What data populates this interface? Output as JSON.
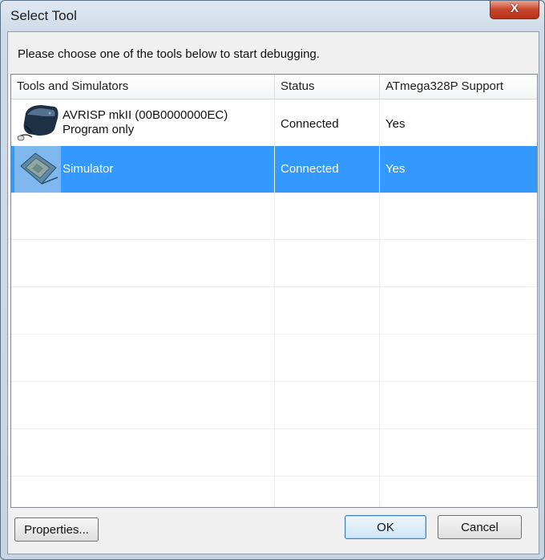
{
  "window": {
    "title": "Select Tool",
    "close_glyph": "X"
  },
  "instruction": "Please choose one of the tools below to start debugging.",
  "columns": [
    "Tools and Simulators",
    "Status",
    "ATmega328P Support"
  ],
  "rows": [
    {
      "name": "AVRISP mkII (00B0000000EC)",
      "subtitle": "Program only",
      "status": "Connected",
      "support": "Yes",
      "icon": "programmer-device-icon",
      "selected": false
    },
    {
      "name": "Simulator",
      "subtitle": "",
      "status": "Connected",
      "support": "Yes",
      "icon": "simulator-chip-icon",
      "selected": true
    }
  ],
  "buttons": {
    "properties": "Properties...",
    "ok": "OK",
    "cancel": "Cancel"
  },
  "colors": {
    "selection": "#3399ff",
    "close": "#c7452b"
  }
}
